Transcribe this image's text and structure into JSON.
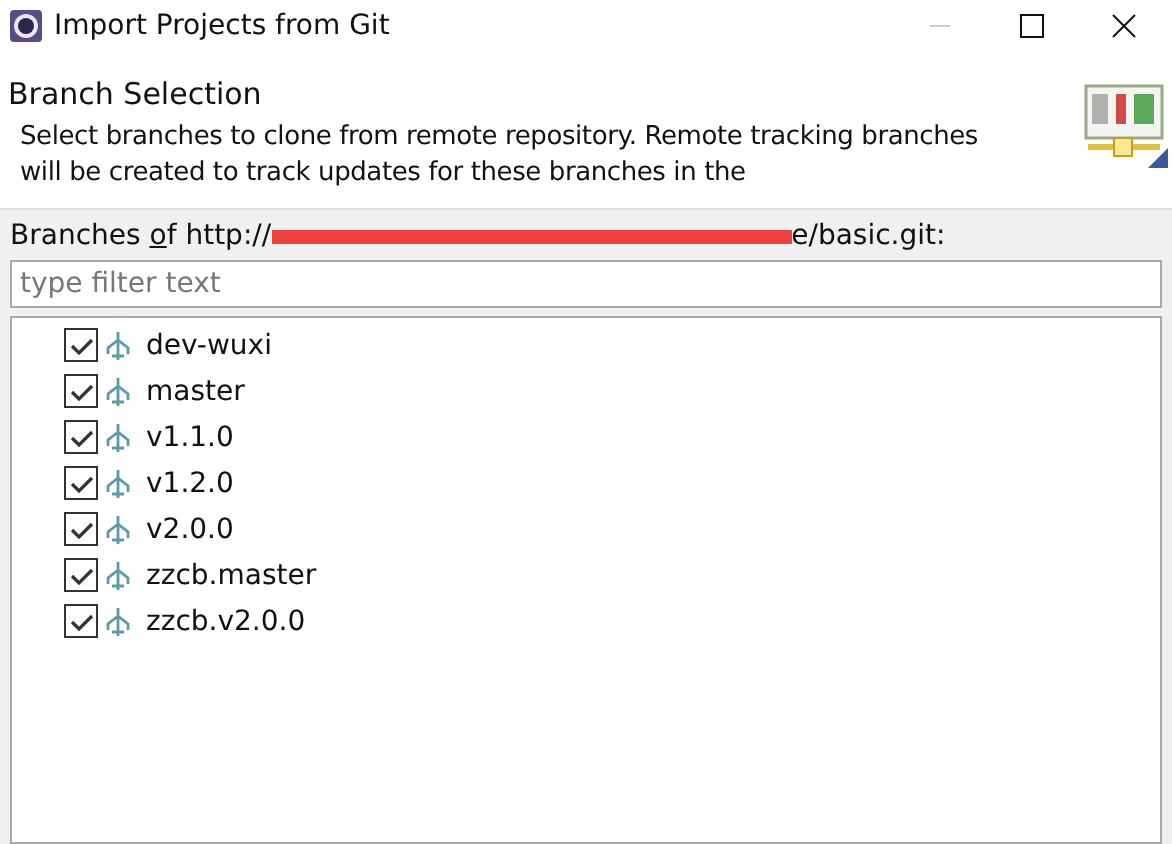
{
  "window": {
    "title": "Import Projects from Git"
  },
  "header": {
    "title": "Branch Selection",
    "description": "Select branches to clone from remote repository. Remote tracking branches will be created to track updates for these branches in the"
  },
  "source_label": {
    "before": "Branches ",
    "mnemonic": "o",
    "after": "f http://",
    "redacted": true,
    "tail": "e/basic.git:"
  },
  "filter": {
    "placeholder": "type filter text"
  },
  "branches": [
    {
      "name": "dev-wuxi",
      "checked": true
    },
    {
      "name": "master",
      "checked": true
    },
    {
      "name": "v1.1.0",
      "checked": true
    },
    {
      "name": "v1.2.0",
      "checked": true
    },
    {
      "name": "v2.0.0",
      "checked": true
    },
    {
      "name": "zzcb.master",
      "checked": true
    },
    {
      "name": "zzcb.v2.0.0",
      "checked": true
    }
  ]
}
